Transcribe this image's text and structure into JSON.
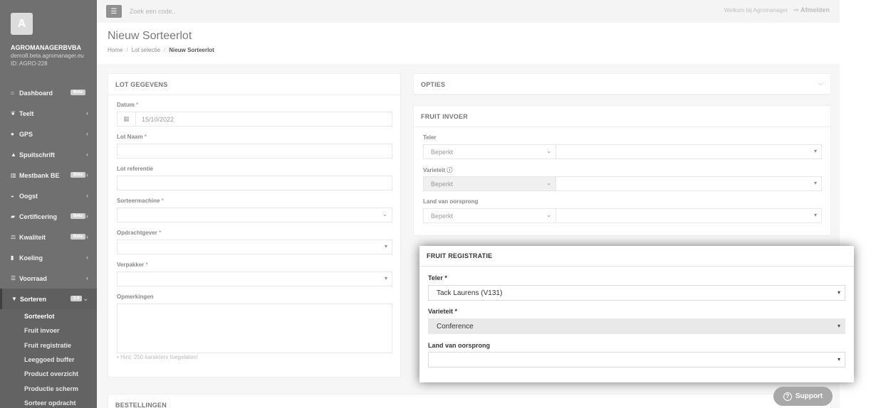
{
  "sidebar": {
    "avatar_letter": "A",
    "company": "AGROMANAGERBVBA",
    "domain": "demo8.beta.agromanager.eu",
    "id": "ID: AGRO-228",
    "items": [
      {
        "label": "Dashboard",
        "icon": "home-icon",
        "badge": "Beta"
      },
      {
        "label": "Teelt",
        "icon": "leaf-icon",
        "chevron": "‹"
      },
      {
        "label": "GPS",
        "icon": "map-marker-icon",
        "chevron": "‹"
      },
      {
        "label": "Spuitschrift",
        "icon": "drop-icon",
        "chevron": "‹"
      },
      {
        "label": "Mestbank BE",
        "icon": "bank-icon",
        "badge": "Beta",
        "chevron": "‹"
      },
      {
        "label": "Oogst",
        "icon": "basket-icon",
        "chevron": "‹"
      },
      {
        "label": "Certificering",
        "icon": "certificate-icon",
        "badge": "Beta",
        "chevron": "‹"
      },
      {
        "label": "Kwaliteit",
        "icon": "scale-icon",
        "badge": "Beta",
        "chevron": "‹"
      },
      {
        "label": "Koeling",
        "icon": "thermometer-icon",
        "chevron": "‹"
      },
      {
        "label": "Voorraad",
        "icon": "list-icon",
        "chevron": "‹"
      },
      {
        "label": "Sorteren",
        "icon": "filter-icon",
        "badge": "2.0",
        "chevron": "⌄"
      }
    ],
    "sub_items": [
      "Sorteerlot",
      "Fruit invoer",
      "Fruit registratie",
      "Leeggoed buffer",
      "Product overzicht",
      "Productie scherm",
      "Sorteer opdracht"
    ]
  },
  "topbar": {
    "search_placeholder": "Zoek een code..",
    "welcome": "Welkom bij Agromanager",
    "logout": "Afmelden"
  },
  "page": {
    "title": "Nieuw Sorteerlot",
    "breadcrumb": [
      "Home",
      "Lot selectie",
      "Nieuw Sorteerlot"
    ]
  },
  "lot": {
    "title": "LOT GEGEVENS",
    "datum_label": "Datum",
    "datum_value": "15/10/2022",
    "naam_label": "Lot Naam",
    "ref_label": "Lot referentie",
    "machine_label": "Sorteermachine",
    "opdracht_label": "Opdrachtgever",
    "verpakker_label": "Verpakker",
    "opmerkingen_label": "Opmerkingen",
    "hint": "Hint: 250 karakters toegelaten!"
  },
  "opties": {
    "title": "OPTIES"
  },
  "invoer": {
    "title": "FRUIT INVOER",
    "teler_label": "Teler",
    "teler_value": "Beperkt",
    "varieteit_label": "Varieteit",
    "varieteit_value": "Beperkt",
    "land_label": "Land van oorsprong",
    "land_value": "Beperkt"
  },
  "registratie": {
    "title": "FRUIT REGISTRATIE",
    "teler_label": "Teler",
    "teler_value": "Tack Laurens (V131)",
    "varieteit_label": "Varieteit",
    "varieteit_value": "Conference",
    "land_label": "Land van oorsprong",
    "land_value": ""
  },
  "bestellingen": {
    "title": "BESTELLINGEN"
  },
  "support": {
    "label": "Support"
  }
}
